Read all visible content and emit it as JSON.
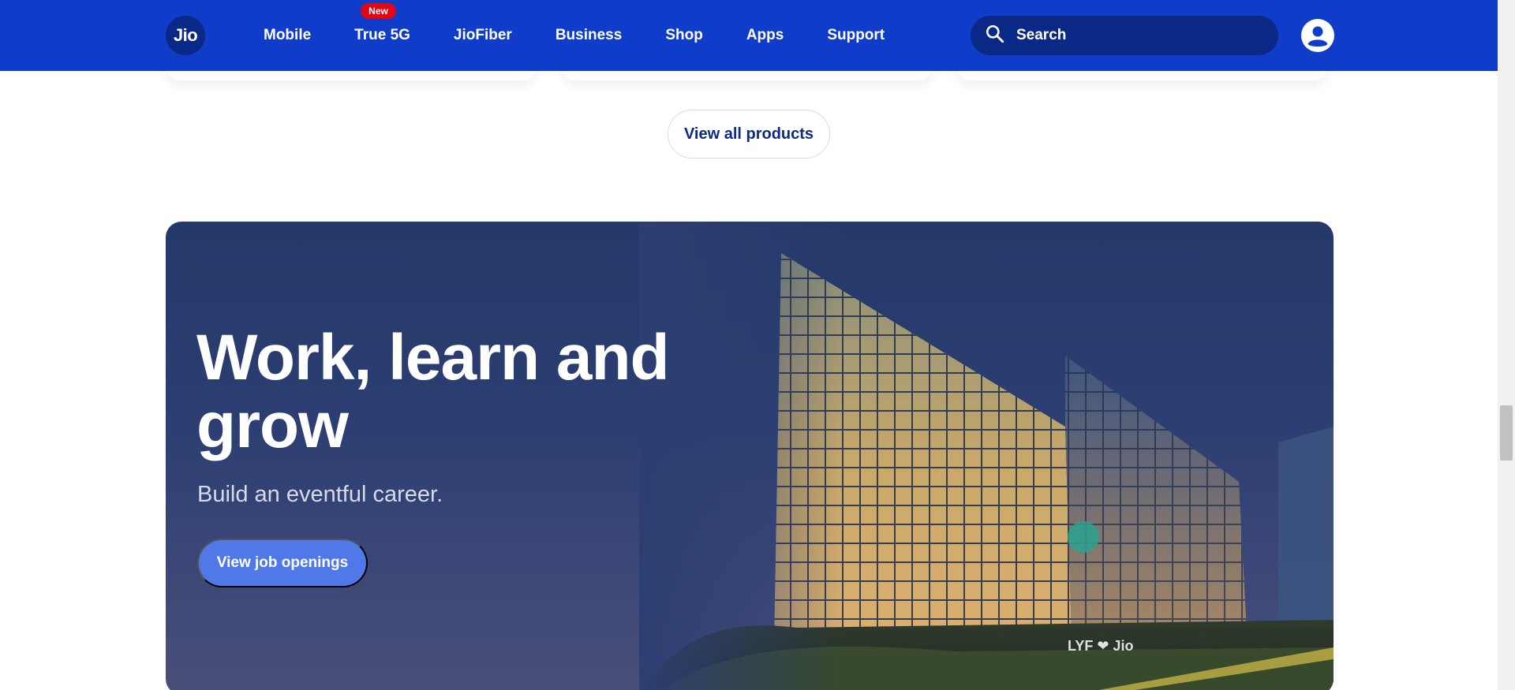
{
  "header": {
    "logo_text": "Jio",
    "nav": [
      {
        "label": "Mobile"
      },
      {
        "label": "True 5G",
        "badge": "New"
      },
      {
        "label": "JioFiber"
      },
      {
        "label": "Business"
      },
      {
        "label": "Shop"
      },
      {
        "label": "Apps"
      },
      {
        "label": "Support"
      }
    ],
    "search_placeholder": "Search",
    "brand_color": "#0f3cc9"
  },
  "products": {
    "view_all_label": "View all products"
  },
  "careers": {
    "title": "Work, learn and grow",
    "subtitle": "Build an eventful career.",
    "button_label": "View job openings",
    "building_sign": "LYF ❤ Jio"
  },
  "icons": [
    "search-icon",
    "user-icon"
  ]
}
